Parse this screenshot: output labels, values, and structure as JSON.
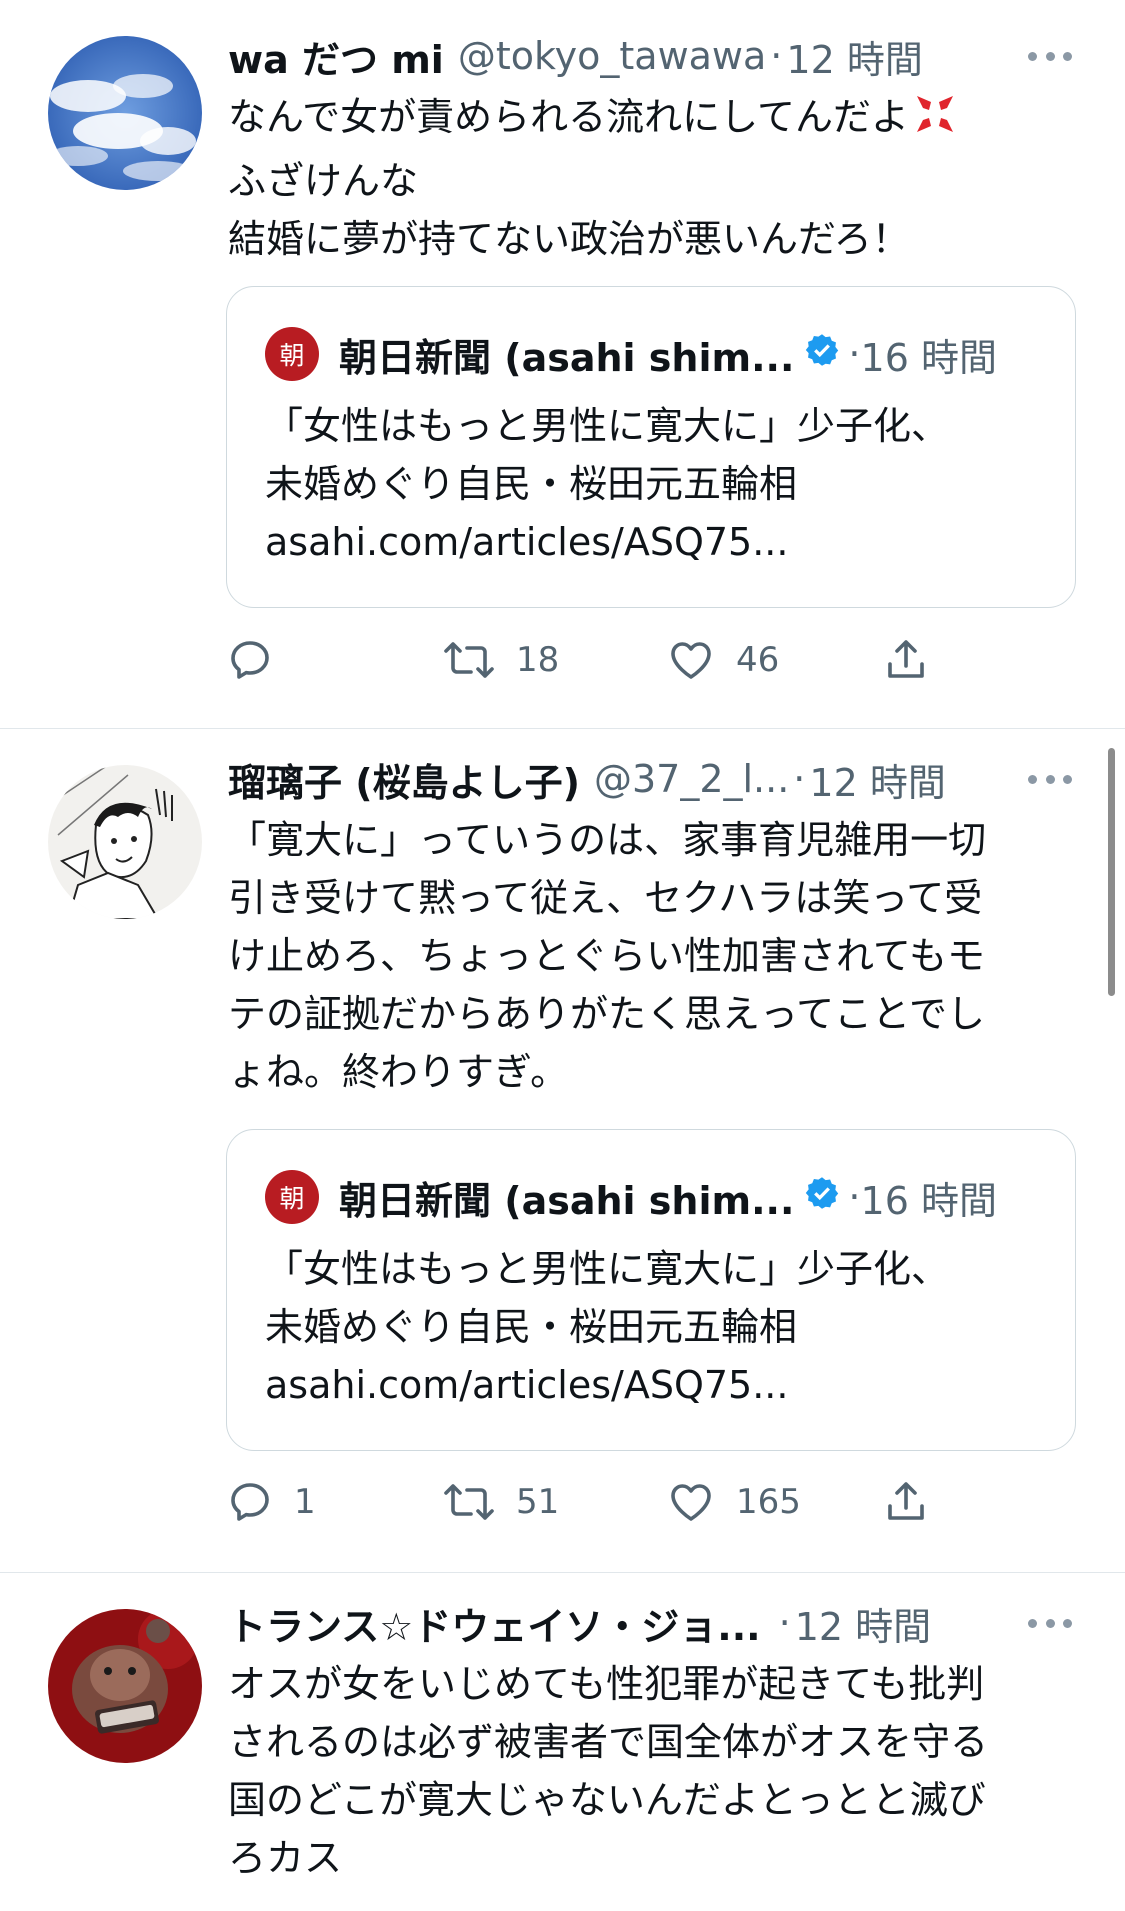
{
  "tweets": [
    {
      "display_name": "wa だつ mi",
      "handle": "@tokyo_tawawa",
      "separator": "·",
      "time": "12 時間",
      "avatar": "sky-avatar",
      "lines": [
        "なんで女が責められる流れにしてんだよ",
        "ふざけんな",
        "結婚に夢が持てない政治が悪いんだろ！"
      ],
      "emoji": "anger-symbol-icon",
      "quote": {
        "logo": "朝",
        "name": "朝日新聞 (asahi shim...",
        "separator": "·",
        "time": "16 時間",
        "lines": [
          "「女性はもっと男性に寛大に」少子化、",
          "未婚めぐり自民・桜田元五輪相",
          "asahi.com/articles/ASQ75..."
        ]
      },
      "replies": "",
      "retweets": "18",
      "likes": "46"
    },
    {
      "display_name": "瑠璃子 (桜島よし子)",
      "handle": "@37_2_l...",
      "separator": "·",
      "time": "12 時間",
      "avatar": "manga-avatar",
      "lines": [
        "「寛大に」っていうのは、家事育児雑用一切",
        "引き受けて黙って従え、セクハラは笑って受",
        "け止めろ、ちょっとぐらい性加害されてもモ",
        "テの証拠だからありがたく思えってことでし",
        "ょね。終わりすぎ。"
      ],
      "quote": {
        "logo": "朝",
        "name": "朝日新聞 (asahi shim...",
        "separator": "·",
        "time": "16 時間",
        "lines": [
          "「女性はもっと男性に寛大に」少子化、",
          "未婚めぐり自民・桜田元五輪相",
          "asahi.com/articles/ASQ75..."
        ]
      },
      "replies": "1",
      "retweets": "51",
      "likes": "165"
    },
    {
      "display_name": "トランス☆ドウェイソ・ジョ...",
      "handle": "",
      "separator": "·",
      "time": "12 時間",
      "avatar": "plush-avatar",
      "lines": [
        "オスが女をいじめても性犯罪が起きても批判",
        "されるのは必ず被害者で国全体がオスを守る",
        "国のどこが寛大じゃないんだよとっとと滅び",
        "ろカス"
      ]
    }
  ],
  "colors": {
    "text_primary": "#0f1419",
    "text_secondary": "#536471",
    "border": "#cfd9de",
    "verified": "#1d9bf0",
    "asahi_logo": "#b81c22"
  }
}
